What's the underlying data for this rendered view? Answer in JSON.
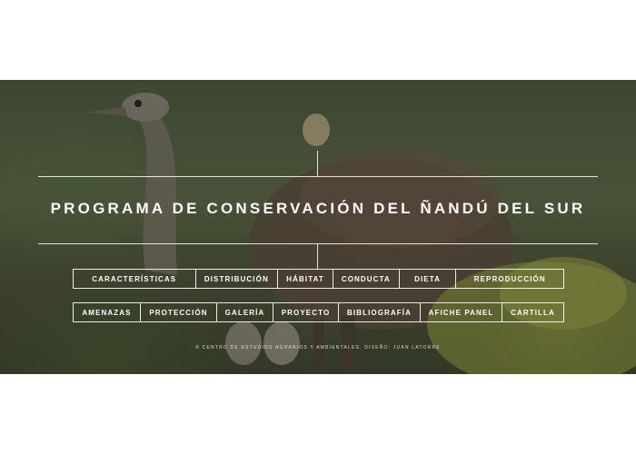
{
  "page": {
    "title": "PROGRAMA DE CONSERVACIÓN DEL ÑANDÚ DEL SUR",
    "credit": "© CENTRO DE ESTUDIOS AGRARIOS Y AMBIENTALES. DISEÑO: JUAN LATORRE"
  },
  "menu": {
    "row1": [
      "CARACTERÍSTICAS",
      "DISTRIBUCIÓN",
      "HÁBITAT",
      "CONDUCTA",
      "DIETA",
      "REPRODUCCIÓN"
    ],
    "row2": [
      "AMENAZAS",
      "PROTECCIÓN",
      "GALERÍA",
      "PROYECTO",
      "BIBLIOGRAFÍA",
      "AFICHE PANEL",
      "CARTILLA"
    ]
  },
  "colors": {
    "text": "#ffffff",
    "background": "#ffffff",
    "hero_tint": "#4c5a3f"
  }
}
